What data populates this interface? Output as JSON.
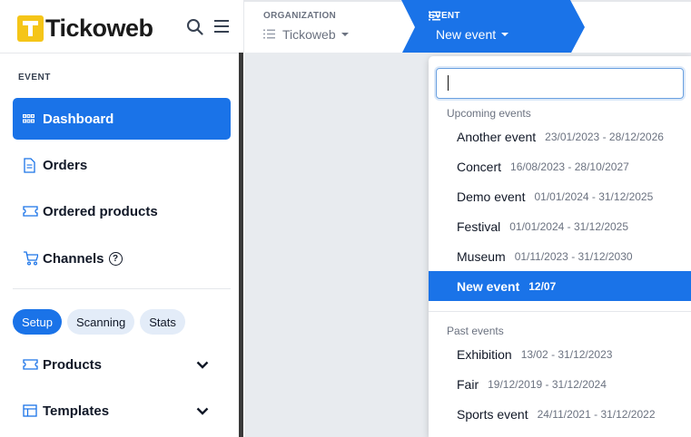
{
  "brand": {
    "name": "Tickoweb",
    "logo_color": "#f5c518",
    "accent": "#1a73e8"
  },
  "sidebar": {
    "section_label": "EVENT",
    "nav": [
      {
        "label": "Dashboard",
        "icon": "grid-icon",
        "active": true
      },
      {
        "label": "Orders",
        "icon": "document-icon"
      },
      {
        "label": "Ordered products",
        "icon": "ticket-icon"
      },
      {
        "label": "Channels",
        "icon": "cart-icon",
        "help": "?"
      }
    ],
    "tabs": [
      {
        "label": "Setup",
        "active": true
      },
      {
        "label": "Scanning"
      },
      {
        "label": "Stats"
      }
    ],
    "groups": [
      {
        "label": "Products",
        "icon": "ticket-icon"
      },
      {
        "label": "Templates",
        "icon": "template-icon"
      }
    ]
  },
  "breadcrumb": {
    "organization": {
      "label": "ORGANIZATION",
      "value": "Tickoweb"
    },
    "event": {
      "label": "EVENT",
      "value": "New event"
    }
  },
  "dropdown": {
    "search_value": "",
    "upcoming_label": "Upcoming events",
    "upcoming": [
      {
        "name": "Another event",
        "dates": "23/01/2023 - 28/12/2026"
      },
      {
        "name": "Concert",
        "dates": "16/08/2023 - 28/10/2027"
      },
      {
        "name": "Demo event",
        "dates": "01/01/2024 - 31/12/2025"
      },
      {
        "name": "Festival",
        "dates": "01/01/2024 - 31/12/2025"
      },
      {
        "name": "Museum",
        "dates": "01/11/2023 - 31/12/2030"
      },
      {
        "name": "New event",
        "dates": "12/07",
        "selected": true
      }
    ],
    "past_label": "Past events",
    "past": [
      {
        "name": "Exhibition",
        "dates": "13/02 - 31/12/2023"
      },
      {
        "name": "Fair",
        "dates": "19/12/2019 - 31/12/2024"
      },
      {
        "name": "Sports event",
        "dates": "24/11/2021 - 31/12/2022"
      }
    ]
  }
}
